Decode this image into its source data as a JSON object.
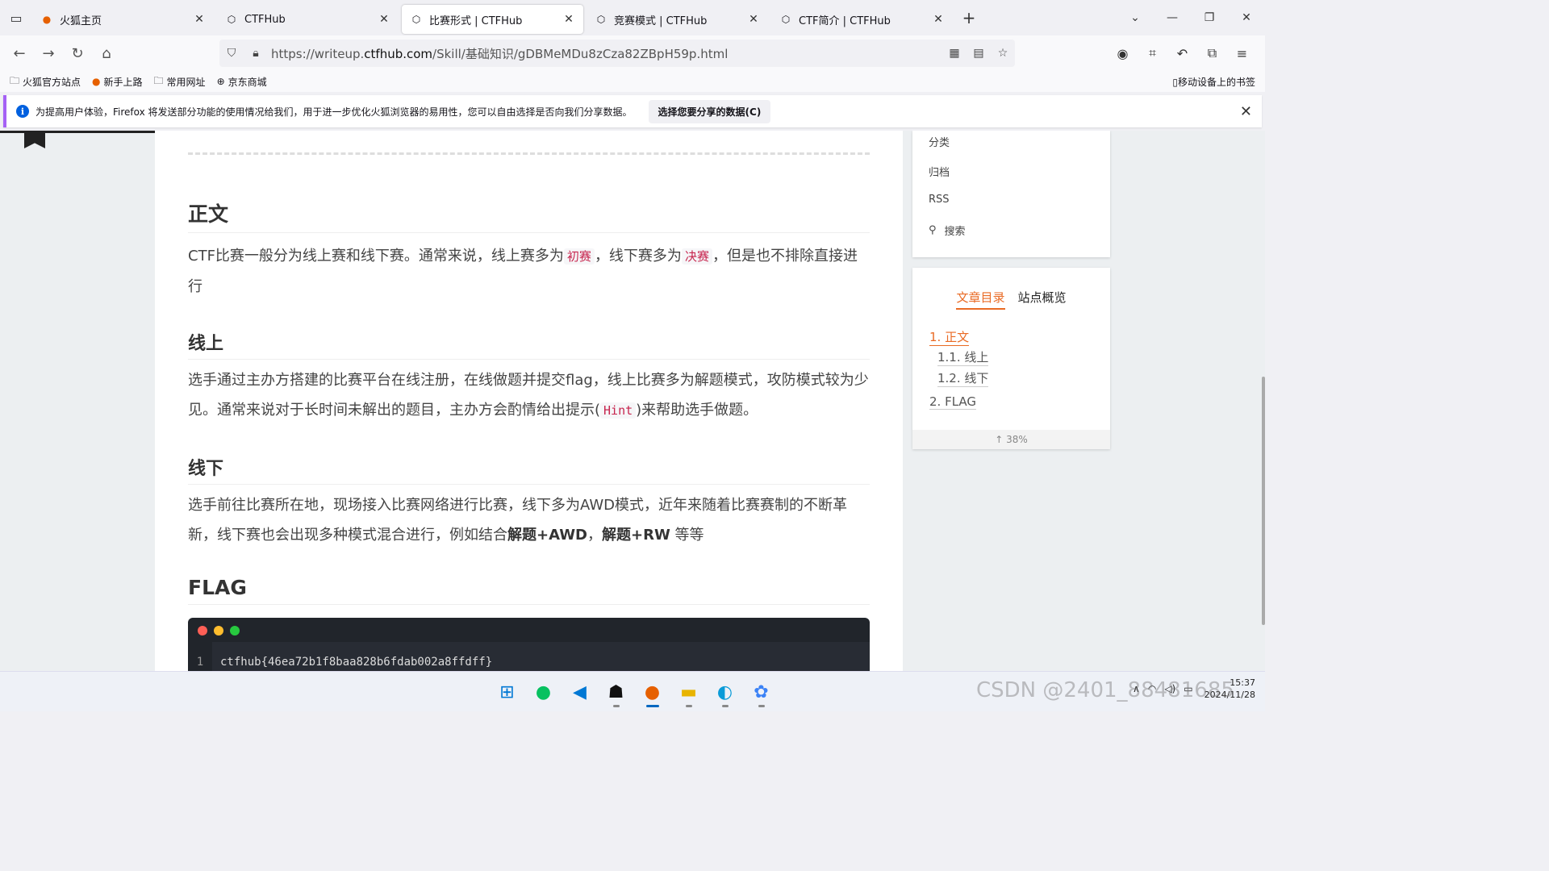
{
  "browser": {
    "tabs": [
      {
        "label": "火狐主页",
        "icon": "firefox-icon"
      },
      {
        "label": "CTFHub",
        "icon": "ctfhub-icon"
      },
      {
        "label": "比赛形式 | CTFHub",
        "icon": "ctfhub-icon",
        "active": true
      },
      {
        "label": "竞赛模式 | CTFHub",
        "icon": "ctfhub-icon"
      },
      {
        "label": "CTF简介 | CTFHub",
        "icon": "ctfhub-icon"
      }
    ],
    "url_prefix": "https://writeup.",
    "url_domain": "ctfhub.com",
    "url_path": "/Skill/基础知识/gDBMeMDu8zCza82ZBpH59p.html",
    "bookmarks": [
      "火狐官方站点",
      "新手上路",
      "常用网址",
      "京东商城"
    ],
    "mobile_bookmarks": "移动设备上的书签",
    "notice_text": "为提高用户体验，Firefox 将发送部分功能的使用情况给我们，用于进一步优化火狐浏览器的易用性，您可以自由选择是否向我们分享数据。",
    "notice_button": "选择您要分享的数据(C)"
  },
  "article": {
    "h_main": "正文",
    "p_main_1": "CTF比赛一般分为线上赛和线下赛。通常来说，线上赛多为",
    "code_1": "初赛",
    "p_main_2": "，线下赛多为",
    "code_2": "决赛",
    "p_main_3": "，但是也不排除直接进行",
    "h_online": "线上",
    "p_online_1": "选手通过主办方搭建的比赛平台在线注册，在线做题并提交flag，线上比赛多为解题模式，攻防模式较为少见。通常来说对于长时间未解出的题目，主办方会酌情给出提示(",
    "code_hint": "Hint",
    "p_online_2": ")来帮助选手做题。",
    "h_offline": "线下",
    "p_offline_1": "选手前往比赛所在地，现场接入比赛网络进行比赛，线下多为AWD模式，近年来随着比赛赛制的不断革新，线下赛也会出现多种模式混合进行，例如结合",
    "b_1": "解题+AWD",
    "p_offline_2": "，",
    "b_2": "解题+RW",
    "p_offline_3": " 等等",
    "h_flag": "FLAG",
    "code_line_no": "1",
    "code_text": "ctfhub{46ea72b1f8baa828b6fdab002a8ffdff}"
  },
  "sidebar": {
    "menu": [
      "分类",
      "归档",
      "RSS",
      "搜索"
    ],
    "toc_tabs": [
      "文章目录",
      "站点概览"
    ],
    "toc": [
      {
        "label": "1. 正文",
        "active": true
      },
      {
        "label": "1.1. 线上"
      },
      {
        "label": "1.2. 线下"
      },
      {
        "label": "2. FLAG"
      }
    ],
    "progress": "38%",
    "progress_fraction": 0.38
  },
  "taskbar": {
    "apps": [
      "windows-start-icon",
      "wechat-icon",
      "vscode-icon",
      "qq-icon",
      "firefox-icon",
      "file-explorer-icon",
      "edge-icon",
      "baidu-netdisk-icon"
    ],
    "time": "15:37",
    "date": "2024/11/28",
    "watermark": "CSDN @2401_88481685"
  },
  "colors": {
    "accent": "#e96a24",
    "code_pink": "#c7254e",
    "notice_border": "#a561f5"
  }
}
